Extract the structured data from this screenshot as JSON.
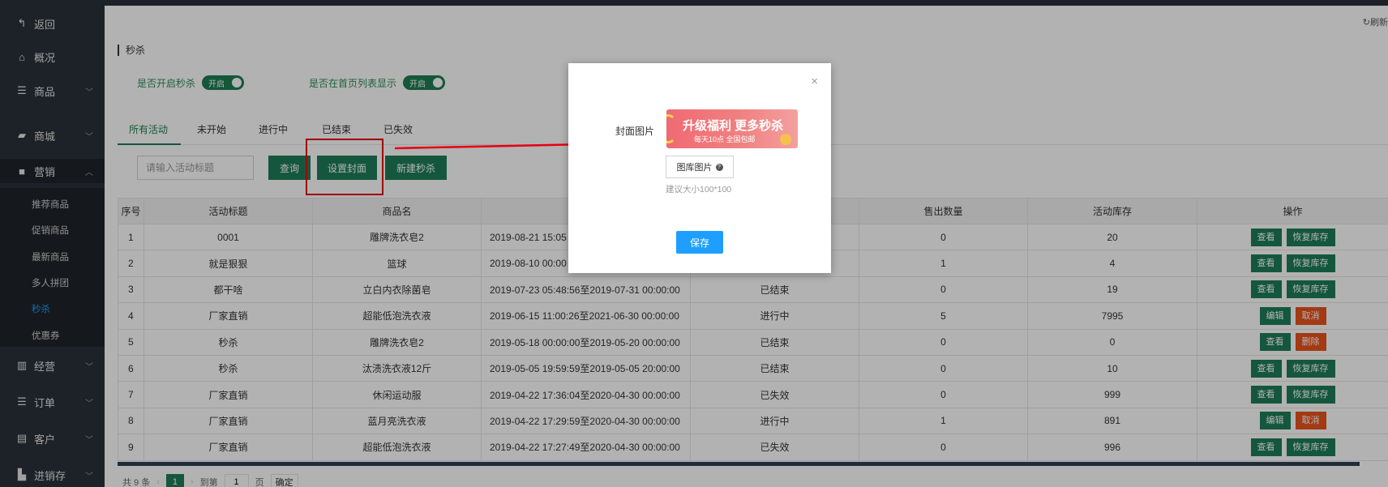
{
  "sidebar": {
    "items": [
      {
        "label": "返回",
        "icon": "back-arrow-icon"
      },
      {
        "label": "概况",
        "icon": "home-icon"
      },
      {
        "label": "商品",
        "icon": "list-icon"
      },
      {
        "label": "商城",
        "icon": "shop-icon"
      },
      {
        "label": "营销",
        "icon": "gift-icon"
      },
      {
        "label": "经营",
        "icon": "bar-chart-icon"
      },
      {
        "label": "订单",
        "icon": "list-icon"
      },
      {
        "label": "客户",
        "icon": "id-card-icon"
      },
      {
        "label": "进销存",
        "icon": "truck-icon"
      }
    ],
    "submenu": [
      "推荐商品",
      "促销商品",
      "最新商品",
      "多人拼团",
      "秒杀",
      "优惠券"
    ],
    "active_sub": "秒杀"
  },
  "header": {
    "refresh_label": "刷新"
  },
  "page": {
    "title": "秒杀",
    "opt1_label": "是否开启秒杀",
    "opt1_switch": "开启",
    "opt2_label": "是否在首页列表显示",
    "opt2_switch": "开启"
  },
  "tabs": [
    "所有活动",
    "未开始",
    "进行中",
    "已结束",
    "已失效"
  ],
  "toolbar": {
    "search_placeholder": "请输入活动标题",
    "query_label": "查询",
    "cover_label": "设置封面",
    "new_label": "新建秒杀"
  },
  "table": {
    "headers": [
      "序号",
      "活动标题",
      "商品名",
      "",
      "",
      "售出数量",
      "活动库存",
      "操作"
    ],
    "rows": [
      {
        "seq": "1",
        "title": "0001",
        "product": "雕牌洗衣皂2",
        "time": "2019-08-21 15:05",
        "status": "",
        "sold": "0",
        "stock": "20",
        "ops": [
          "查看",
          "恢复库存"
        ]
      },
      {
        "seq": "2",
        "title": "就是狠狠",
        "product": "篮球",
        "time": "2019-08-10 00:00",
        "status": "",
        "sold": "1",
        "stock": "4",
        "ops": [
          "查看",
          "恢复库存"
        ]
      },
      {
        "seq": "3",
        "title": "都干啥",
        "product": "立白内衣除菌皂",
        "time": "2019-07-23 05:48:56至2019-07-31 00:00:00",
        "status": "已结束",
        "sold": "0",
        "stock": "19",
        "ops": [
          "查看",
          "恢复库存"
        ]
      },
      {
        "seq": "4",
        "title": "厂家直销",
        "product": "超能低泡洗衣液",
        "time": "2019-06-15 11:00:26至2021-06-30 00:00:00",
        "status": "进行中",
        "sold": "5",
        "stock": "7995",
        "ops": [
          "编辑",
          "取消"
        ]
      },
      {
        "seq": "5",
        "title": "秒杀",
        "product": "雕牌洗衣皂2",
        "time": "2019-05-18 00:00:00至2019-05-20 00:00:00",
        "status": "已结束",
        "sold": "0",
        "stock": "0",
        "ops": [
          "查看",
          "删除"
        ]
      },
      {
        "seq": "6",
        "title": "秒杀",
        "product": "汰渍洗衣液12斤",
        "time": "2019-05-05 19:59:59至2019-05-05 20:00:00",
        "status": "已结束",
        "sold": "0",
        "stock": "10",
        "ops": [
          "查看",
          "恢复库存"
        ]
      },
      {
        "seq": "7",
        "title": "厂家直销",
        "product": "休闲运动服",
        "time": "2019-04-22 17:36:04至2020-04-30 00:00:00",
        "status": "已失效",
        "sold": "0",
        "stock": "999",
        "ops": [
          "查看",
          "恢复库存"
        ]
      },
      {
        "seq": "8",
        "title": "厂家直销",
        "product": "蓝月亮洗衣液",
        "time": "2019-04-22 17:29:59至2020-04-30 00:00:00",
        "status": "进行中",
        "sold": "1",
        "stock": "891",
        "ops": [
          "编辑",
          "取消"
        ]
      },
      {
        "seq": "9",
        "title": "厂家直销",
        "product": "超能低泡洗衣液",
        "time": "2019-04-22 17:27:49至2020-04-30 00:00:00",
        "status": "已失效",
        "sold": "0",
        "stock": "996",
        "ops": [
          "查看",
          "恢复库存"
        ]
      }
    ]
  },
  "pager": {
    "total_text": "共 9 条",
    "prev": "‹",
    "current": "1",
    "next": "›",
    "goto_label": "到第",
    "goto_value": "1",
    "page_unit": "页",
    "confirm_label": "确定"
  },
  "modal": {
    "close": "×",
    "cover_label": "封面图片",
    "banner_main": "升级福利 更多秒杀",
    "banner_sub": "每天10点 全国包邮",
    "gallery_label": "图库图片",
    "help_icon": "?",
    "hint": "建议大小100*100",
    "save_label": "保存"
  },
  "colors": {
    "accent": "#1e7d5a",
    "primary": "#1e9fff",
    "danger": "#e9531e",
    "highlight": "#e60012"
  }
}
